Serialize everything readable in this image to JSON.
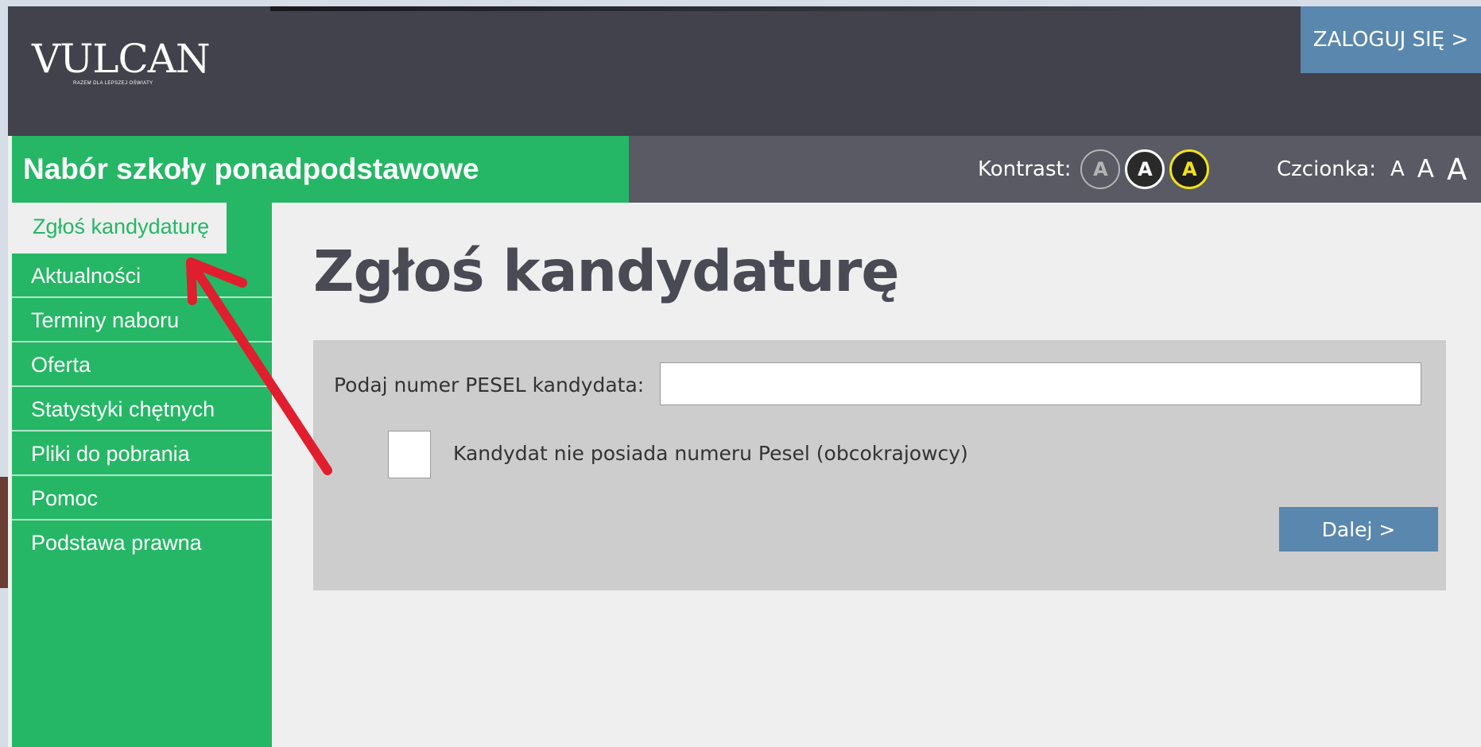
{
  "header": {
    "logo": {
      "name": "VULCAN",
      "tagline": "RAZEM DLA LEPSZEJ OŚWIATY"
    },
    "login_label": "ZALOGUJ SIĘ >"
  },
  "subheader": {
    "title": "Nabór szkoły ponadpodstawowe",
    "contrast": {
      "label": "Kontrast:",
      "options": [
        "A",
        "A",
        "A"
      ]
    },
    "font": {
      "label": "Czcionka:",
      "options": [
        "A",
        "A",
        "A"
      ]
    }
  },
  "sidebar": {
    "items": [
      {
        "label": "Zgłoś kandydaturę",
        "active": true
      },
      {
        "label": "Aktualności"
      },
      {
        "label": "Terminy naboru"
      },
      {
        "label": "Oferta"
      },
      {
        "label": "Statystyki chętnych"
      },
      {
        "label": "Pliki do pobrania"
      },
      {
        "label": "Pomoc"
      },
      {
        "label": "Podstawa prawna"
      }
    ]
  },
  "main": {
    "title": "Zgłoś kandydaturę",
    "pesel_label": "Podaj numer PESEL kandydata:",
    "pesel_value": "",
    "no_pesel_label": "Kandydat nie posiada numeru Pesel (obcokrajowcy)",
    "no_pesel_checked": false,
    "next_label": "Dalej >"
  },
  "colors": {
    "brand_green": "#25b765",
    "topbar": "#42424c",
    "subbar": "#5a5a64",
    "button_blue": "#5a87ad",
    "annotation_arrow": "#e01e2e"
  }
}
